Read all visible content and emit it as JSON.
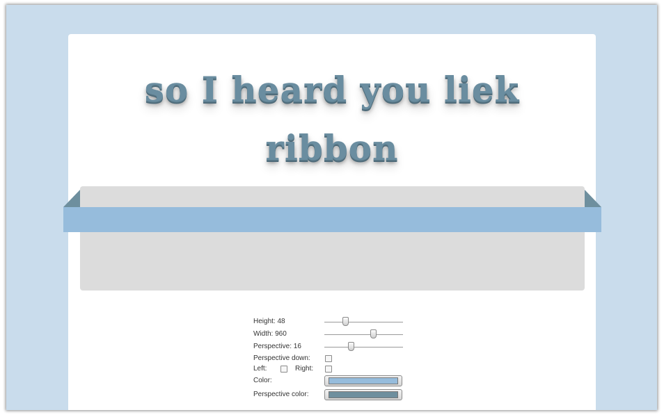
{
  "heading": {
    "line1": "so I heard you liek",
    "line2": "ribbon"
  },
  "colors": {
    "page_background": "#c9dcec",
    "ribbon_color": "#96bcdc",
    "perspective_color": "#6e8f9e",
    "heading_color": "#6a8da0"
  },
  "controls": {
    "height_label": "Height: 48",
    "width_label": "Width: 960",
    "perspective_label": "Perspective: 16",
    "perspective_down_label": "Perspective down:",
    "left_label": "Left:",
    "right_label": "Right:",
    "color_label": "Color:",
    "perspective_color_label": "Perspective color:",
    "height_value": 48,
    "width_value": 960,
    "perspective_value": 16,
    "height_fraction": 0.25,
    "width_fraction": 0.63,
    "perspective_fraction": 0.33,
    "perspective_down_checked": false,
    "left_checked": false,
    "right_checked": false
  }
}
